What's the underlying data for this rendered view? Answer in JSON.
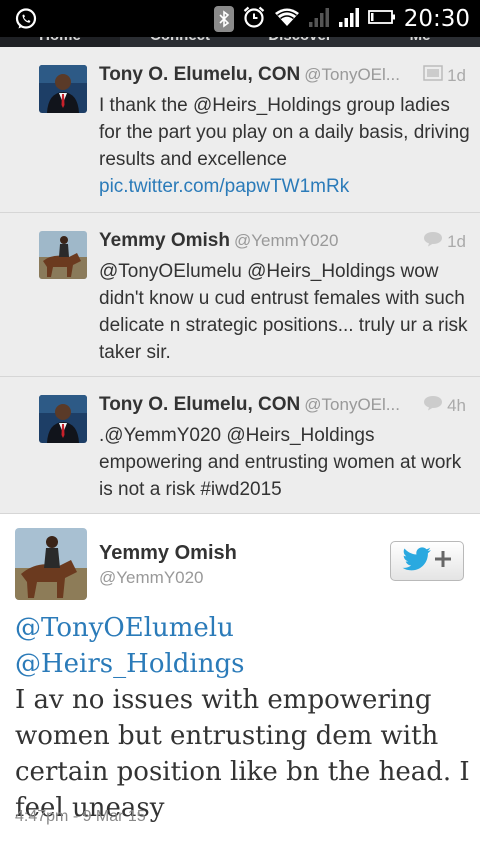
{
  "status_bar": {
    "time": "20:30",
    "icons": [
      "whatsapp-icon",
      "bluetooth-icon",
      "alarm-icon",
      "wifi-icon",
      "signal-icon",
      "signal-icon",
      "battery-icon"
    ]
  },
  "tabs": [
    {
      "label": "Home",
      "active": true
    },
    {
      "label": "Connect",
      "active": false
    },
    {
      "label": "Discover",
      "active": false
    },
    {
      "label": "Me",
      "active": false
    }
  ],
  "timeline": [
    {
      "name": "Tony O. Elumelu, CON",
      "handle": "@TonyOEl...",
      "time": "1d",
      "meta_icon": "photo-icon",
      "text": "I thank the @Heirs_Holdings group ladies for the part you play on a daily basis, driving results and excellence",
      "link": "pic.twitter.com/papwTW1mRk"
    },
    {
      "name": "Yemmy Omish",
      "handle": "@YemmY020",
      "time": "1d",
      "meta_icon": "conversation-icon",
      "text": "@TonyOElumelu @Heirs_Holdings wow didn't know u cud entrust females with such delicate n strategic positions... truly ur a risk taker sir."
    },
    {
      "name": "Tony O. Elumelu, CON",
      "handle": "@TonyOEl...",
      "time": "4h",
      "meta_icon": "conversation-icon",
      "text": ".@YemmY020 @Heirs_Holdings empowering and entrusting women at work is not a risk #iwd2015"
    }
  ],
  "detail": {
    "name": "Yemmy Omish",
    "handle": "@YemmY020",
    "mentions": "@TonyOElumelu @Heirs_Holdings",
    "text": "I av no issues with empowering women but entrusting dem with certain position like bn the head. I feel uneasy",
    "timestamp": "4:47pm - 9 Mar 15",
    "follow_icon": "follow-bird-plus-icon"
  },
  "colors": {
    "link": "#2b7bb9",
    "timeline_bg": "#ededed",
    "status_bar_bg": "#000000",
    "twitter_blue": "#2aa9e0"
  }
}
